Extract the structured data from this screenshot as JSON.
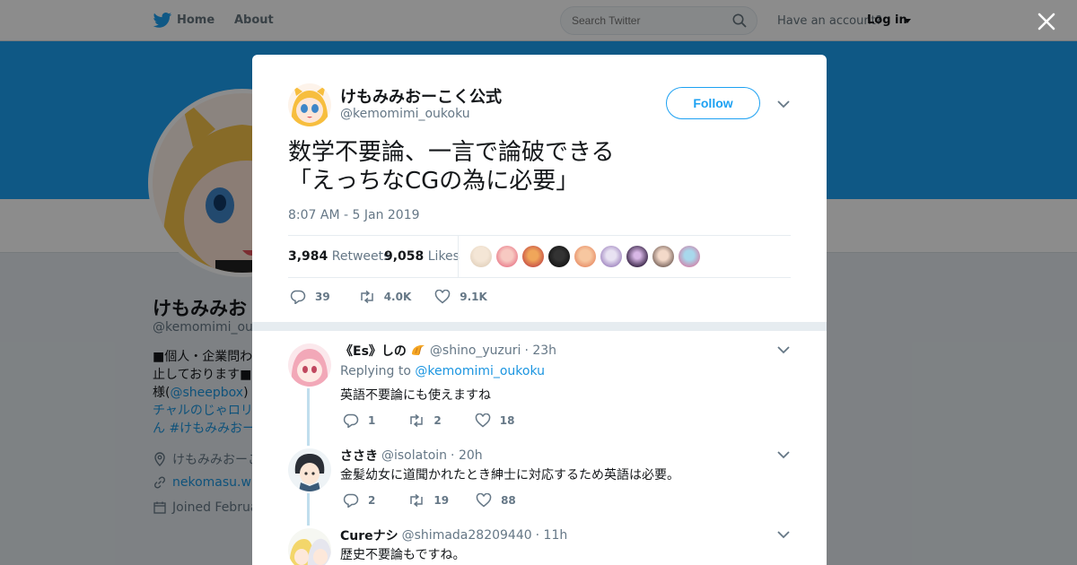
{
  "topbar": {
    "home_label": "Home",
    "about_label": "About",
    "search_placeholder": "Search Twitter",
    "account_text": "Have an account?",
    "login_label": "Log in"
  },
  "profile_bg": {
    "name": "けもみみお",
    "handle": "@kemomimi_ouko",
    "bio_line1": "■個人・企業問わず",
    "bio_line2": "止しております■",
    "bio_line3_prefix": "様(",
    "bio_line3_link": "@sheepbox",
    "bio_line3_suffix": ")【",
    "bio_line4": "チャルのじゃロリ",
    "bio_line5": "ん #けもみみおー",
    "location": "けもみみおーこ",
    "website": "nekomasu.wix",
    "joined": "Joined Februa"
  },
  "tweet": {
    "author_name": "けもみみおーこく公式",
    "author_handle": "@kemomimi_oukoku",
    "follow_label": "Follow",
    "text": "数学不要論、一言で論破できる\n「えっちなCGの為に必要」",
    "timestamp": "8:07 AM - 5 Jan 2019",
    "retweets_count": "3,984",
    "retweets_label": "Retweets",
    "likes_count": "9,058",
    "likes_label": "Likes",
    "replies_action": "39",
    "retweets_action": "4.0K",
    "likes_action": "9.1K"
  },
  "replies": [
    {
      "name": "《Es》しの",
      "handle": "@shino_yuzuri",
      "time": "· 23h",
      "replying_prefix": "Replying to",
      "replying_to": "@kemomimi_oukoku",
      "text": "英語不要論にも使えますね",
      "replies": "1",
      "retweets": "2",
      "likes": "18"
    },
    {
      "name": "ささき",
      "handle": "@isolatoin",
      "time": "· 20h",
      "text": "金髪幼女に道聞かれたとき紳士に対応するため英語は必要。",
      "replies": "2",
      "retweets": "19",
      "likes": "88"
    },
    {
      "name": "Cureナシ",
      "handle": "@shimada28209440",
      "time": "· 11h",
      "text": "歴史不要論もですね。"
    }
  ],
  "colors": {
    "accent": "#1da1f2",
    "link": "#1b95e0",
    "muted": "#657786",
    "thread": "#c0deed"
  }
}
